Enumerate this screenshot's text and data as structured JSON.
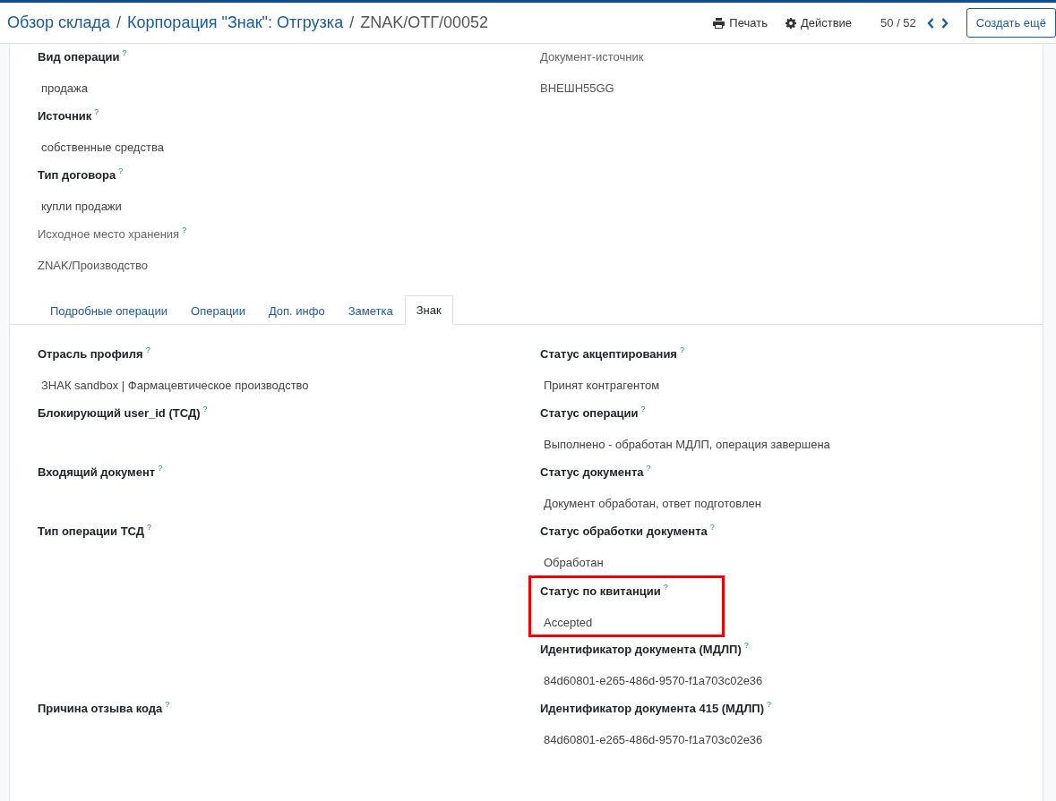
{
  "header": {
    "breadcrumbs": [
      {
        "label": "Обзор склада",
        "link": true
      },
      {
        "label": "Корпорация \"Знак\": Отгрузка",
        "link": true
      },
      {
        "label": "ZNAK/ОТГ/00052",
        "link": false
      }
    ],
    "separator": "/",
    "actions": [
      {
        "kind": "print",
        "label": "Печать"
      },
      {
        "kind": "action",
        "label": "Действие"
      }
    ],
    "pager": "50 / 52",
    "create_button": "Создать ещё"
  },
  "top_fields": {
    "left": [
      {
        "label": "Вид операции",
        "help": "?",
        "value": "продажа",
        "bold": true
      },
      {
        "label": "Источник",
        "help": "?",
        "value": "собственные средства",
        "bold": true
      },
      {
        "label": "Тип договора",
        "help": "?",
        "value": "купли продажи",
        "bold": true
      },
      {
        "label": "Исходное место хранения",
        "help": "?",
        "value": "ZNAK/Производство",
        "bold": false
      }
    ],
    "right": [
      {
        "label": "Документ-источник",
        "value": "ВНЕШН55GG",
        "bold": false
      }
    ]
  },
  "tabs": [
    {
      "label": "Подробные операции",
      "selected": false
    },
    {
      "label": "Операции",
      "selected": false
    },
    {
      "label": "Доп. инфо",
      "selected": false
    },
    {
      "label": "Заметка",
      "selected": false
    },
    {
      "label": "Знак",
      "selected": true
    }
  ],
  "tab_fields": {
    "left": [
      {
        "label": "Отрасль профиля",
        "help": "?",
        "value": "ЗНАК sandbox | Фармацевтическое производство",
        "bold": true
      },
      {
        "label": "Блокирующий user_id (ТСД)",
        "help": "?",
        "bold": true
      },
      {
        "label": "Входящий документ",
        "help": "?",
        "bold": true
      },
      {
        "label": "Тип операции ТСД",
        "help": "?",
        "bold": true
      },
      {
        "label": "Причина отзыва кода",
        "help": "?",
        "bold": true
      }
    ],
    "right": [
      {
        "label": "Статус акцептирования",
        "help": "?",
        "value": "Принят контрагентом",
        "bold": true
      },
      {
        "label": "Статус операции",
        "help": "?",
        "value": "Выполнено - обработан МДЛП, операция завершена",
        "bold": true
      },
      {
        "label": "Статус документа",
        "help": "?",
        "value": "Документ обработан, ответ подготовлен",
        "bold": true
      },
      {
        "label": "Статус обработки документа",
        "help": "?",
        "value": "Обработан",
        "bold": true
      },
      {
        "label": "Статус по квитанции",
        "help": "?",
        "value": "Accepted",
        "bold": true,
        "highlighted": true
      },
      {
        "label": "Идентификатор документа (МДЛП)",
        "help": "?",
        "value": "84d60801-e265-486d-9570-f1a703c02e36",
        "bold": true
      },
      {
        "label": "Идентификатор документа 415 (МДЛП)",
        "help": "?",
        "value": "84d60801-e265-486d-9570-f1a703c02e36",
        "bold": true
      }
    ]
  }
}
